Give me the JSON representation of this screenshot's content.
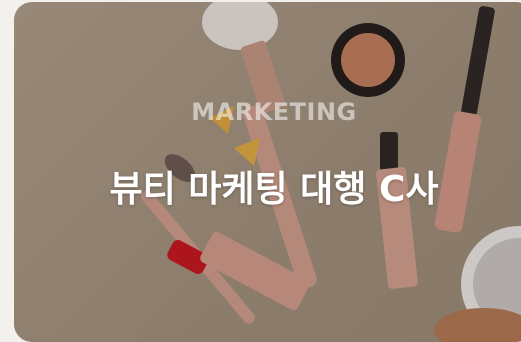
{
  "card": {
    "category": "MARKETING",
    "title": "뷰티 마케팅 대행 C사"
  },
  "image": {
    "subject": "makeup-products-icon"
  },
  "colors": {
    "background": "#a4937f",
    "title": "#ffffff"
  }
}
